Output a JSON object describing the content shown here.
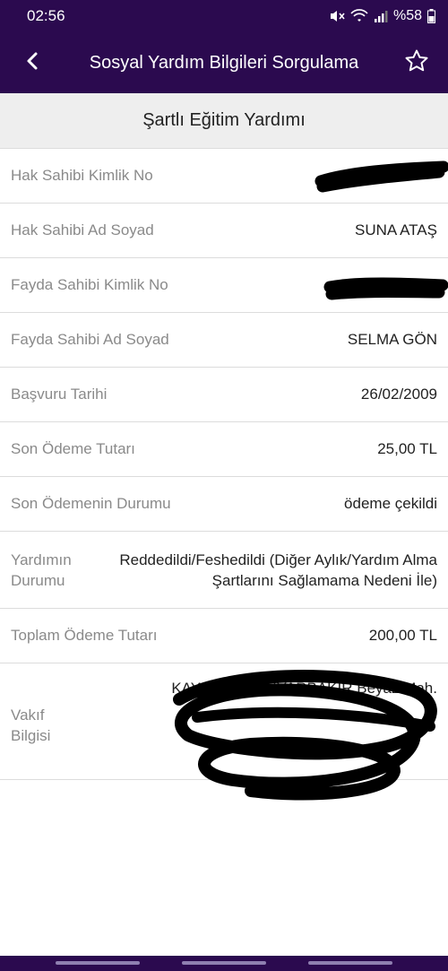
{
  "status": {
    "time": "02:56",
    "battery": "%58"
  },
  "appbar": {
    "title": "Sosyal Yardım Bilgileri Sorgulama"
  },
  "section": {
    "title": "Şartlı Eğitim Yardımı"
  },
  "rows": [
    {
      "label": "Hak Sahibi Kimlik No",
      "value": ""
    },
    {
      "label": "Hak Sahibi Ad Soyad",
      "value": "SUNA ATAŞ"
    },
    {
      "label": "Fayda Sahibi Kimlik No",
      "value": ""
    },
    {
      "label": "Fayda Sahibi Ad Soyad",
      "value": "SELMA GÖN"
    },
    {
      "label": "Başvuru Tarihi",
      "value": "26/02/2009"
    },
    {
      "label": "Son Ödeme Tutarı",
      "value": "25,00 TL"
    },
    {
      "label": "Son Ödemenin Durumu",
      "value": "ödeme çekildi"
    },
    {
      "label_line1": "Yardımın",
      "label_line2": "Durumu",
      "value": "Reddedildi/Feshedildi (Diğer Aylık/Yardım Alma Şartlarını Sağlamama Nedeni İle)"
    },
    {
      "label": "Toplam Ödeme Tutarı",
      "value": "200,00 TL"
    },
    {
      "label_line1": "Vakıf",
      "label_line2": "Bilgisi",
      "value_line1": "KAYAPINAR-DİYARBAKIR Beyaz Mah.",
      "value_line2": "",
      "value_line3": "",
      "value_line4": ""
    }
  ]
}
